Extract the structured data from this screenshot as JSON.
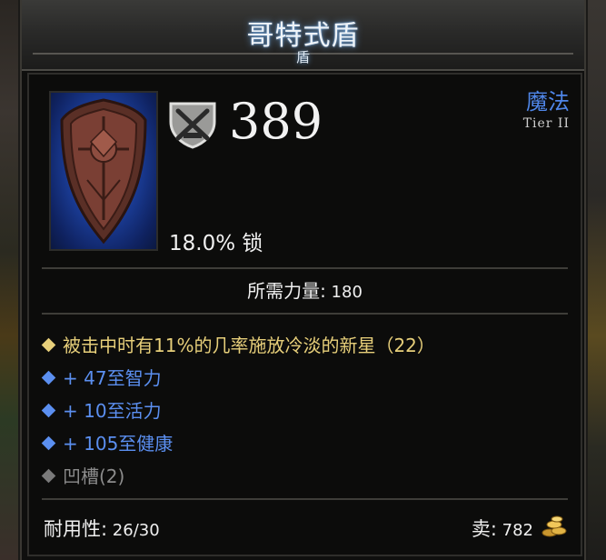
{
  "item": {
    "name": "哥特式盾",
    "type": "盾",
    "quality": "魔法",
    "tier": "Tier II",
    "armor_value": "389",
    "block_text": "18.0% 锁",
    "requirement_label": "所需力量:",
    "requirement_value": " 180",
    "affixes": [
      {
        "kind": "legendary",
        "text": "被击中时有11%的几率施放冷淡的新星（22）"
      },
      {
        "kind": "magic",
        "text": "+ 47至智力"
      },
      {
        "kind": "magic",
        "text": "+ 10至活力"
      },
      {
        "kind": "magic",
        "text": "+ 105至健康"
      },
      {
        "kind": "socket",
        "text": "凹槽(2)"
      }
    ],
    "durability_label": "耐用性:",
    "durability_value": " 26/30",
    "sell_label": "卖:",
    "sell_value": " 782"
  },
  "icons": {
    "item": "gothic-shield-icon",
    "armor": "armor-shield-icon",
    "gold": "gold-coins-icon"
  },
  "colors": {
    "title_glow": "#6eaae6",
    "magic": "#5b8ff0",
    "legendary": "#e7cf7a",
    "socket": "#8c8c8c",
    "quality": "#4f86e8"
  }
}
